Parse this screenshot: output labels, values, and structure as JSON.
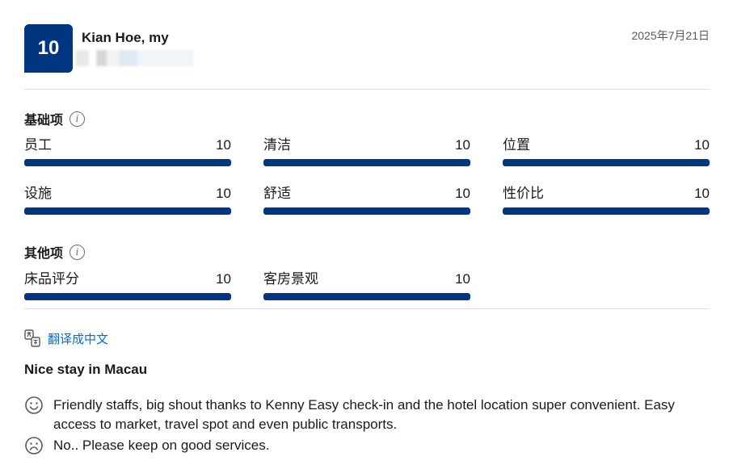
{
  "review": {
    "score": "10",
    "reviewer_name": "Kian Hoe, my",
    "date": "2025年7月21日",
    "title": "Nice stay in Macau",
    "positive": "Friendly staffs, big shout thanks to Kenny Easy check-in and the hotel location super convenient. Easy access to market, travel spot and even public transports.",
    "negative": "No.. Please keep on good services.",
    "translate_label": "翻译成中文"
  },
  "sections": {
    "basic_title": "基础项",
    "other_title": "其他项"
  },
  "ratings": {
    "basic": [
      {
        "label": "员工",
        "value": "10",
        "fraction": 1.0
      },
      {
        "label": "清洁",
        "value": "10",
        "fraction": 1.0
      },
      {
        "label": "位置",
        "value": "10",
        "fraction": 1.0
      },
      {
        "label": "设施",
        "value": "10",
        "fraction": 1.0
      },
      {
        "label": "舒适",
        "value": "10",
        "fraction": 1.0
      },
      {
        "label": "性价比",
        "value": "10",
        "fraction": 1.0
      }
    ],
    "other": [
      {
        "label": "床品评分",
        "value": "10",
        "fraction": 1.0
      },
      {
        "label": "客房景观",
        "value": "10",
        "fraction": 1.0
      }
    ]
  },
  "colors": {
    "brand": "#003580",
    "link": "#006ce4"
  },
  "icons": {
    "info": "info-icon",
    "translate": "translate-icon",
    "positive": "smile-icon",
    "negative": "frown-icon"
  }
}
